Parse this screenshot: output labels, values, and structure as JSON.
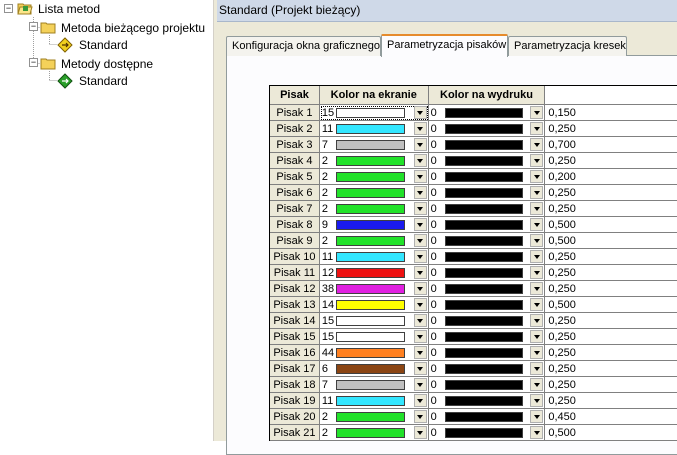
{
  "tree": {
    "root": {
      "label": "Lista metod",
      "icon": "folder-open-icon"
    },
    "groups": [
      {
        "label": "Metoda bieżącego projektu",
        "icon": "folder-icon",
        "children": [
          {
            "label": "Standard",
            "icon": "method-diamond-yellow-icon",
            "color": "#f0d020"
          }
        ]
      },
      {
        "label": "Metody dostępne",
        "icon": "folder-icon",
        "children": [
          {
            "label": "Standard",
            "icon": "method-diamond-green-icon",
            "color": "#2aa02a"
          }
        ]
      }
    ]
  },
  "panel": {
    "title": "Standard (Projekt bieżący)",
    "tabs": [
      {
        "label": "Konfiguracja okna graficznego",
        "active": false
      },
      {
        "label": "Parametryzacja pisaków",
        "active": true
      },
      {
        "label": "Parametryzacja kresek",
        "active": false
      }
    ]
  },
  "grid": {
    "headers": {
      "pen": "Pisak",
      "screen": "Kolor na ekranie",
      "print": "Kolor na wydruku",
      "width": ""
    },
    "rows": [
      {
        "pen": "Pisak 1",
        "screen_idx": "15",
        "screen_color": "#ffffff",
        "print_idx": "0",
        "print_color": "#000000",
        "width": "0,150"
      },
      {
        "pen": "Pisak 2",
        "screen_idx": "11",
        "screen_color": "#33e6ff",
        "print_idx": "0",
        "print_color": "#000000",
        "width": "0,250"
      },
      {
        "pen": "Pisak 3",
        "screen_idx": "7",
        "screen_color": "#c0c0c0",
        "print_idx": "0",
        "print_color": "#000000",
        "width": "0,700"
      },
      {
        "pen": "Pisak 4",
        "screen_idx": "2",
        "screen_color": "#22e22a",
        "print_idx": "0",
        "print_color": "#000000",
        "width": "0,250"
      },
      {
        "pen": "Pisak 5",
        "screen_idx": "2",
        "screen_color": "#22e22a",
        "print_idx": "0",
        "print_color": "#000000",
        "width": "0,200"
      },
      {
        "pen": "Pisak 6",
        "screen_idx": "2",
        "screen_color": "#22e22a",
        "print_idx": "0",
        "print_color": "#000000",
        "width": "0,250"
      },
      {
        "pen": "Pisak 7",
        "screen_idx": "2",
        "screen_color": "#22e22a",
        "print_idx": "0",
        "print_color": "#000000",
        "width": "0,250"
      },
      {
        "pen": "Pisak 8",
        "screen_idx": "9",
        "screen_color": "#1a1aee",
        "print_idx": "0",
        "print_color": "#000000",
        "width": "0,500"
      },
      {
        "pen": "Pisak 9",
        "screen_idx": "2",
        "screen_color": "#22e22a",
        "print_idx": "0",
        "print_color": "#000000",
        "width": "0,500"
      },
      {
        "pen": "Pisak 10",
        "screen_idx": "11",
        "screen_color": "#33e6ff",
        "print_idx": "0",
        "print_color": "#000000",
        "width": "0,250"
      },
      {
        "pen": "Pisak 11",
        "screen_idx": "12",
        "screen_color": "#ee1111",
        "print_idx": "0",
        "print_color": "#000000",
        "width": "0,250"
      },
      {
        "pen": "Pisak 12",
        "screen_idx": "38",
        "screen_color": "#e020e0",
        "print_idx": "0",
        "print_color": "#000000",
        "width": "0,250"
      },
      {
        "pen": "Pisak 13",
        "screen_idx": "14",
        "screen_color": "#ffff00",
        "print_idx": "0",
        "print_color": "#000000",
        "width": "0,500"
      },
      {
        "pen": "Pisak 14",
        "screen_idx": "15",
        "screen_color": "#ffffff",
        "print_idx": "0",
        "print_color": "#000000",
        "width": "0,250"
      },
      {
        "pen": "Pisak 15",
        "screen_idx": "15",
        "screen_color": "#ffffff",
        "print_idx": "0",
        "print_color": "#000000",
        "width": "0,250"
      },
      {
        "pen": "Pisak 16",
        "screen_idx": "44",
        "screen_color": "#ff8020",
        "print_idx": "0",
        "print_color": "#000000",
        "width": "0,250"
      },
      {
        "pen": "Pisak 17",
        "screen_idx": "6",
        "screen_color": "#8b4513",
        "print_idx": "0",
        "print_color": "#000000",
        "width": "0,250"
      },
      {
        "pen": "Pisak 18",
        "screen_idx": "7",
        "screen_color": "#c0c0c0",
        "print_idx": "0",
        "print_color": "#000000",
        "width": "0,250"
      },
      {
        "pen": "Pisak 19",
        "screen_idx": "11",
        "screen_color": "#33e6ff",
        "print_idx": "0",
        "print_color": "#000000",
        "width": "0,250"
      },
      {
        "pen": "Pisak 20",
        "screen_idx": "2",
        "screen_color": "#22e22a",
        "print_idx": "0",
        "print_color": "#000000",
        "width": "0,450"
      },
      {
        "pen": "Pisak 21",
        "screen_idx": "2",
        "screen_color": "#22e22a",
        "print_idx": "0",
        "print_color": "#000000",
        "width": "0,500"
      }
    ]
  }
}
